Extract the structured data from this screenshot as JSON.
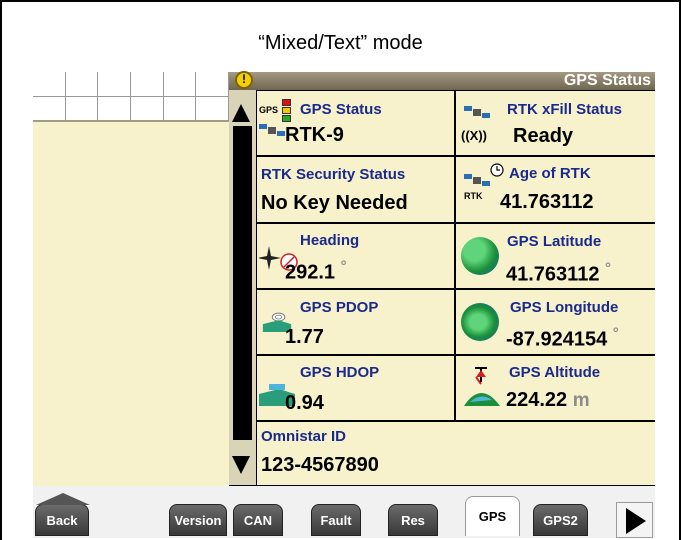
{
  "caption": "“Mixed/Text” mode",
  "titlebar": {
    "title": "GPS Status"
  },
  "cells": {
    "gps_status": {
      "label": "GPS Status",
      "value": "RTK-9",
      "icon_text": "GPS"
    },
    "rtk_xfill": {
      "label": "RTK xFill Status",
      "value": "Ready",
      "icon_text": "((X))"
    },
    "rtk_security": {
      "label": "RTK Security Status",
      "value": "No Key Needed"
    },
    "age_rtk": {
      "label": "Age of RTK",
      "value": "41.763112",
      "icon_text": "RTK"
    },
    "heading": {
      "label": "Heading",
      "value": "292.1",
      "unit": "°"
    },
    "gps_latitude": {
      "label": "GPS Latitude",
      "value": "41.763112",
      "unit": "°"
    },
    "gps_pdop": {
      "label": "GPS PDOP",
      "value": "1.77"
    },
    "gps_longitude": {
      "label": "GPS Longitude",
      "value": "-87.924154",
      "unit": "°"
    },
    "gps_hdop": {
      "label": "GPS HDOP",
      "value": "0.94"
    },
    "gps_altitude": {
      "label": "GPS Altitude",
      "value": "224.22",
      "unit": "m"
    },
    "omnistar_id": {
      "label": "Omnistar ID",
      "value": "123-4567890"
    }
  },
  "tabs": {
    "back": "Back",
    "version": "Version",
    "can": "CAN",
    "fault": "Fault",
    "res": "Res",
    "gps": "GPS",
    "gps2": "GPS2"
  },
  "icons": {
    "warning": "warning-icon",
    "satellite": "satellite-icon",
    "clock": "clock-icon",
    "compass": "compass-icon",
    "globe": "globe-icon",
    "field": "field-icon",
    "altitude": "altitude-icon"
  },
  "colors": {
    "panel_bg": "#f8f2cc",
    "label_blue": "#1a2a8c",
    "titlebar": "#8a806a",
    "tab_dark": "#4a4a4a"
  }
}
